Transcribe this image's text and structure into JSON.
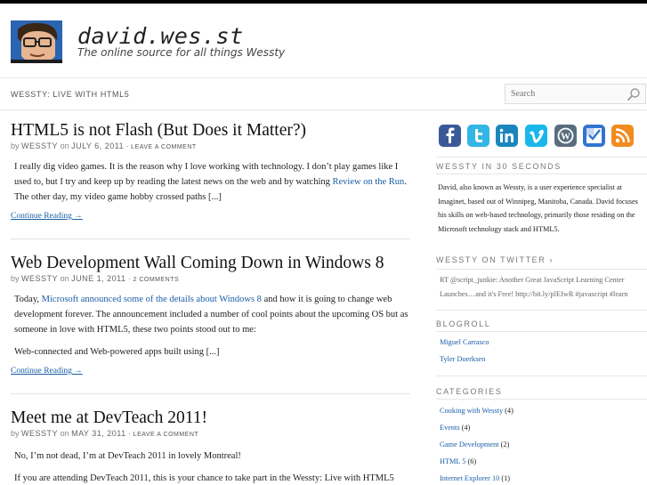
{
  "header": {
    "title": "david.wes.st",
    "tagline": "The online source for all things Wessty"
  },
  "breadcrumb": "WESSTY: LIVE WITH HTML5",
  "search": {
    "placeholder": "Search"
  },
  "posts": [
    {
      "title": "HTML5 is not Flash (But Does it Matter?)",
      "by": "by",
      "author": "WESSTY",
      "on": "on",
      "date": "JULY 6, 2011",
      "sep": "·",
      "comments": "LEAVE A COMMENT",
      "excerpt_before": "I really dig video games. It is the reason why I love working with technology. I don’t play games like I used to, but I try and keep up by reading the latest news on the web and by watching ",
      "excerpt_link": "Review on the Run",
      "excerpt_after": ". The other day, my video game hobby crossed paths [...]",
      "continue": "Continue Reading →"
    },
    {
      "title": "Web Development Wall Coming Down in Windows 8",
      "by": "by",
      "author": "WESSTY",
      "on": "on",
      "date": "JUNE 1, 2011",
      "sep": "·",
      "comments": "2 COMMENTS",
      "excerpt_before": "Today, ",
      "excerpt_link": "Microsoft announced some of the details about Windows 8",
      "excerpt_after": " and how it is going to change web development forever. The announcement included a number of cool points about the upcoming OS but as someone in love with HTML5, these two points stood out to me:",
      "excerpt_p2": "Web-connected and Web-powered apps built using [...]",
      "continue": "Continue Reading →"
    },
    {
      "title": "Meet me at DevTeach 2011!",
      "by": "by",
      "author": "WESSTY",
      "on": "on",
      "date": "MAY 31, 2011",
      "sep": "·",
      "comments": "LEAVE A COMMENT",
      "excerpt_p1": "No, I’m not dead, I’m at DevTeach 2011 in lovely Montreal!",
      "excerpt_p2": "If you are attending DevTeach 2011, this is your chance to take part in the Wessty: Live with HTML5"
    }
  ],
  "sidebar": {
    "social": [
      {
        "icon": "facebook-icon",
        "color": "#3b5998"
      },
      {
        "icon": "twitter-icon",
        "color": "#33b5e5"
      },
      {
        "icon": "linkedin-icon",
        "color": "#1b86bc"
      },
      {
        "icon": "vimeo-icon",
        "color": "#1ab7ea"
      },
      {
        "icon": "wordpress-icon",
        "color": "#5a6d7e"
      },
      {
        "icon": "delicious-icon",
        "color": "#3274d1"
      },
      {
        "icon": "rss-icon",
        "color": "#f28b20"
      }
    ],
    "about_title": "WESSTY IN 30 SECONDS",
    "about_text": "David, also known as Wessty, is a user experience specialist at Imaginet, based out of Winnipeg, Manitoba, Canada. David focuses his skills on web-based technology, primarily those residing on the Microsoft technology stack and HTML5.",
    "twitter_title": "WESSTY ON TWITTER",
    "twitter_arrow": "›",
    "tweet_line1": "RT @script_junkie: Another Great JavaScript Learning Center",
    "tweet_line2": "Launches…and it's Free! http://bit.ly/plEfwR #javascript #learn",
    "blogroll_title": "BLOGROLL",
    "blogroll": [
      "Miguel Carrasco",
      "Tyler Doerksen"
    ],
    "categories_title": "CATEGORIES",
    "categories": [
      {
        "name": "Cooking with Wessty",
        "count": "(4)"
      },
      {
        "name": "Events",
        "count": "(4)"
      },
      {
        "name": "Game Development",
        "count": "(2)"
      },
      {
        "name": "HTML 5",
        "count": "(6)"
      },
      {
        "name": "Internet Explorer 10",
        "count": "(1)"
      }
    ]
  }
}
